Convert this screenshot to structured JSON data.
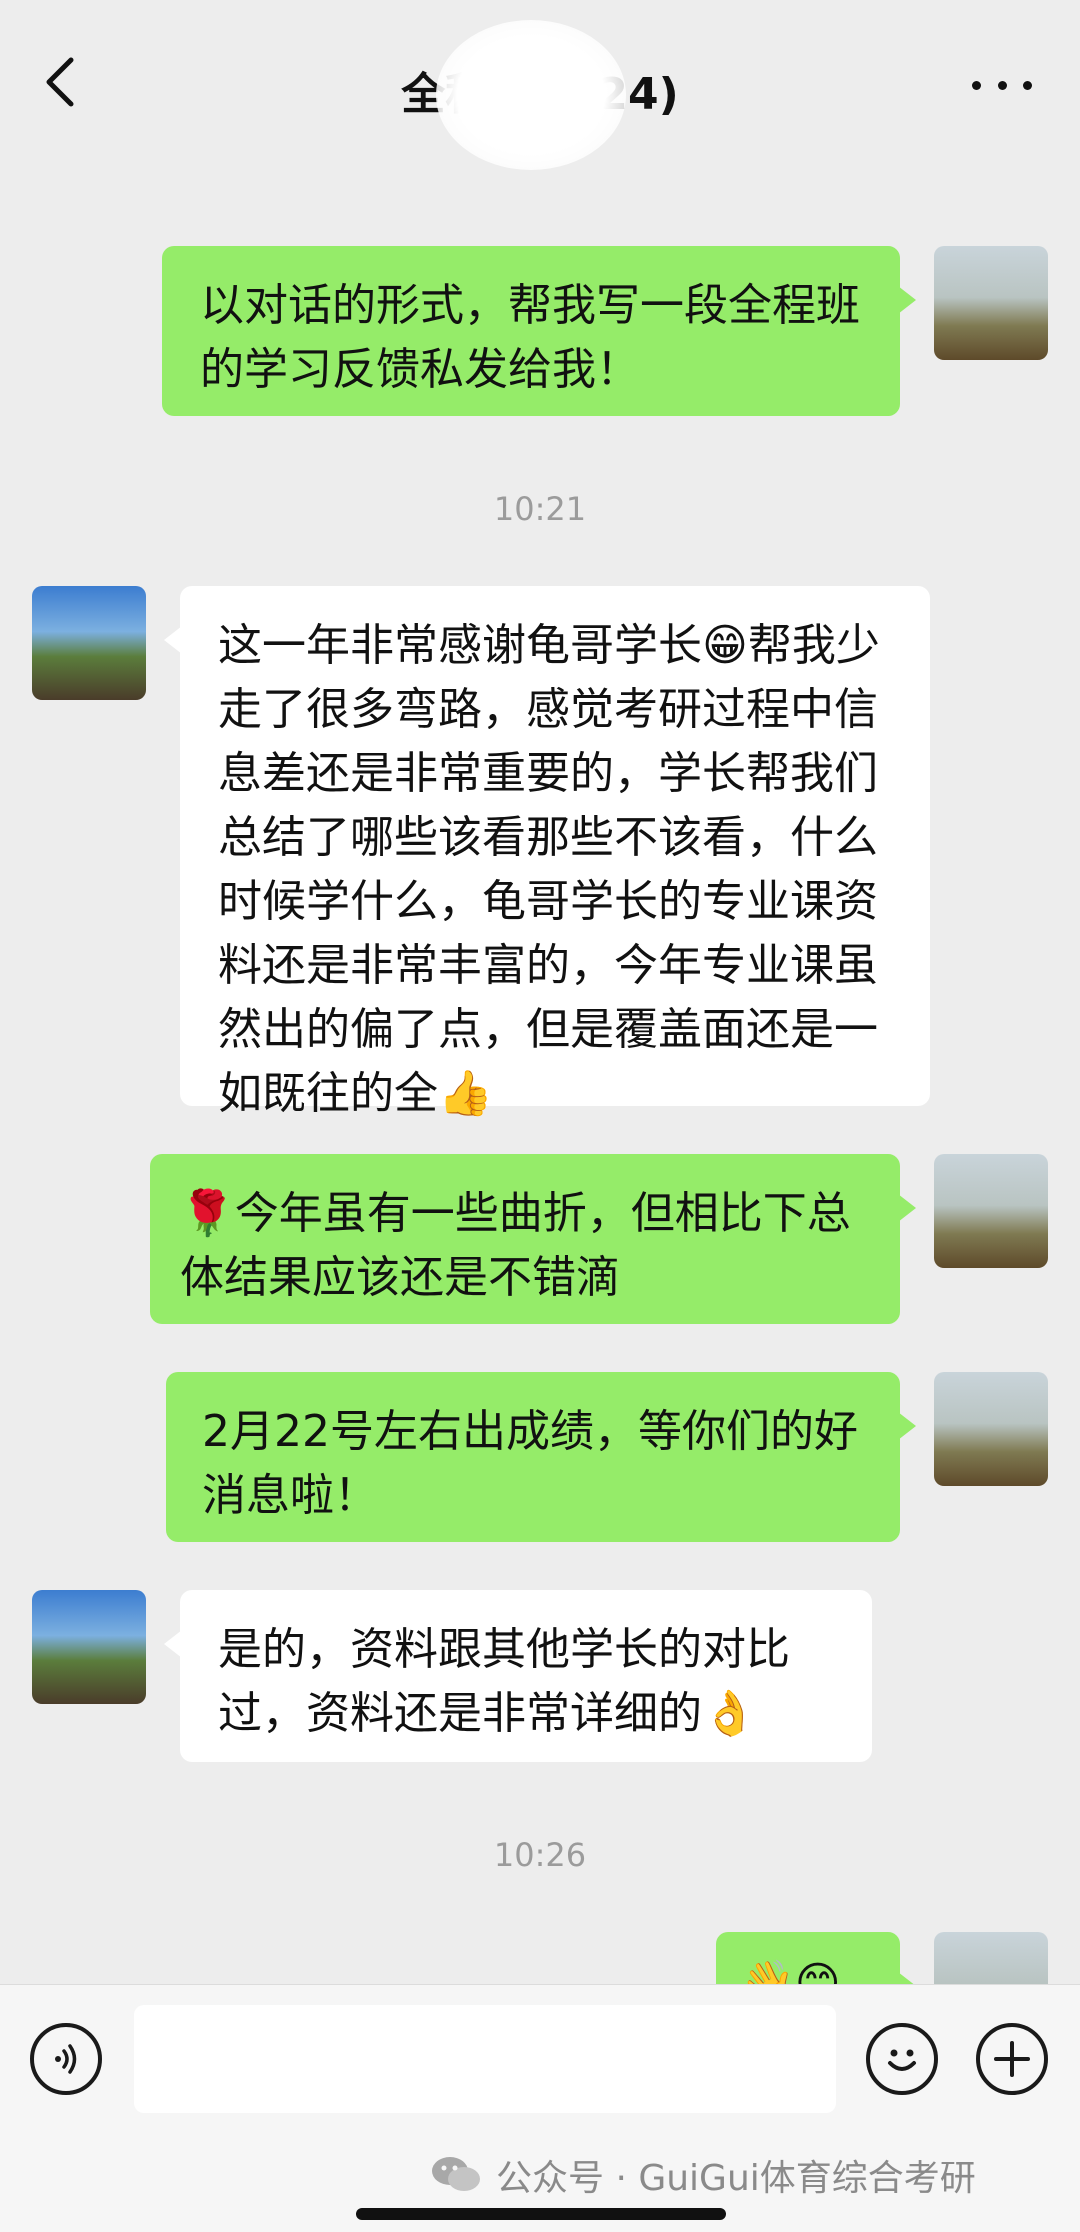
{
  "header": {
    "title": "全程班…(24)",
    "back_icon": "chevron-left-icon",
    "more_icon": "more-dots-icon"
  },
  "timestamps": [
    "10:21",
    "10:26"
  ],
  "messages": [
    {
      "sender": "me",
      "text": "以对话的形式，帮我写一段全程班的学习反馈私发给我！"
    },
    {
      "sender": "other",
      "text": "这一年非常感谢龟哥学长😁帮我少走了很多弯路，感觉考研过程中信息差还是非常重要的，学长帮我们总结了哪些该看那些不该看，什么时候学什么，龟哥学长的专业课资料还是非常丰富的，今年专业课虽然出的偏了点，但是覆盖面还是一如既往的全👍"
    },
    {
      "sender": "me",
      "text": "🌹今年虽有一些曲折，但相比下总体结果应该还是不错滴"
    },
    {
      "sender": "me",
      "text": "2月22号左右出成绩，等你们的好消息啦！"
    },
    {
      "sender": "other",
      "text": "是的，资料跟其他学长的对比过，资料还是非常详细的👌"
    },
    {
      "sender": "me",
      "text": "👋😊"
    }
  ],
  "input": {
    "placeholder": ""
  },
  "watermark": {
    "text": "公众号 · GuiGui体育综合考研"
  },
  "colors": {
    "my_bubble": "#95ec69",
    "other_bubble": "#ffffff",
    "background": "#ededed"
  }
}
